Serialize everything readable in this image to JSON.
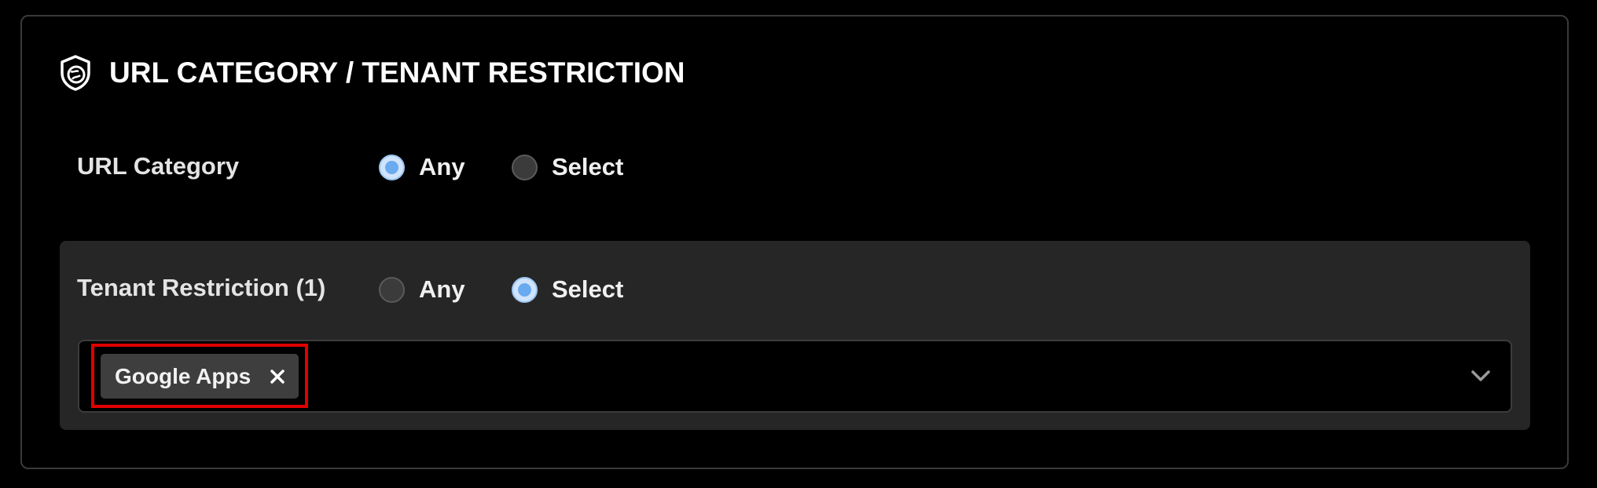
{
  "section": {
    "title": "URL CATEGORY / TENANT RESTRICTION",
    "icon": "shield-globe-icon"
  },
  "url_category": {
    "label": "URL Category",
    "options": [
      {
        "label": "Any",
        "selected": true
      },
      {
        "label": "Select",
        "selected": false
      }
    ]
  },
  "tenant_restriction": {
    "label": "Tenant Restriction (1)",
    "options": [
      {
        "label": "Any",
        "selected": false
      },
      {
        "label": "Select",
        "selected": true
      }
    ],
    "selected_items": [
      {
        "label": "Google Apps",
        "remove_icon": "close-icon"
      }
    ],
    "dropdown_icon": "chevron-down-icon"
  },
  "colors": {
    "background": "#000000",
    "panel_border": "#3a3a3a",
    "subpanel": "#262626",
    "radio_selected": "#6aaaf0",
    "highlight": "#e00000",
    "chip": "#3e3e3e"
  }
}
